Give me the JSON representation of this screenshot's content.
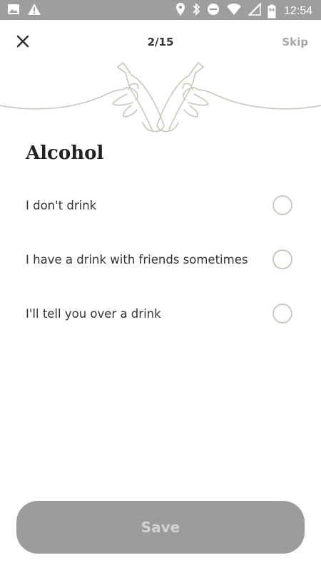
{
  "status_bar": {
    "time": "12:54",
    "left_icons": [
      "image-icon",
      "warning-icon"
    ],
    "right_icons": [
      "location-icon",
      "bluetooth-icon",
      "dnd-icon",
      "wifi-icon",
      "signal-icon",
      "battery-icon"
    ],
    "battery_level": "84"
  },
  "header": {
    "progress": "2/15",
    "skip_label": "Skip"
  },
  "question": {
    "title": "Alcohol"
  },
  "options": [
    {
      "label": "I don't drink",
      "selected": false
    },
    {
      "label": "I have a drink with friends sometimes",
      "selected": false
    },
    {
      "label": "I'll tell you over a drink",
      "selected": false
    }
  ],
  "footer": {
    "save_label": "Save"
  },
  "colors": {
    "status_bar": "#9e9e9e",
    "radio_border": "#cbc9c0",
    "illustration_stroke": "#c9c6bc",
    "save_button_bg": "#9b9b9b",
    "save_button_text": "#d2d2d2",
    "skip_text": "#a6a6a6"
  }
}
